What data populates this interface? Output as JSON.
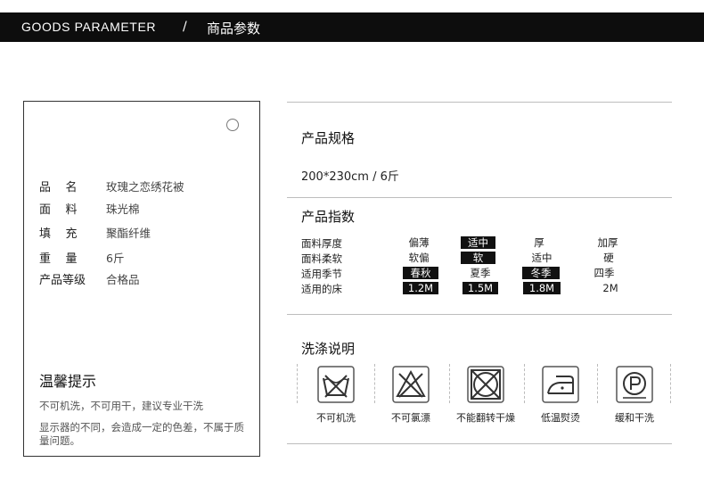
{
  "header": {
    "title_en": "GOODS  PARAMETER",
    "separator": "/",
    "title_cn": "商品参数"
  },
  "card": {
    "rows": [
      {
        "key": "品    名",
        "value": "玫瑰之恋绣花被"
      },
      {
        "key": "面    料",
        "value": "珠光棉"
      },
      {
        "key": "填    充",
        "value": "聚酯纤维"
      },
      {
        "key": "重    量",
        "value": "6斤"
      },
      {
        "key": "产品等级",
        "value": "合格品"
      }
    ],
    "tip_title": "温馨提示",
    "tip_line1": "不可机洗，不可用干，建议专业干洗",
    "tip_line2": "显示器的不同，会造成一定的色差，不属于质量问题。"
  },
  "spec": {
    "title": "产品规格",
    "value": "200*230cm  /  6斤"
  },
  "index": {
    "title": "产品指数",
    "rows": [
      {
        "label": "面料厚度",
        "options": [
          "偏薄",
          "适中",
          "厚",
          "加厚"
        ],
        "selected": 1
      },
      {
        "label": "面料柔软",
        "options": [
          "软偏",
          "软",
          "适中",
          "硬"
        ],
        "selected": 1
      },
      {
        "label": "适用季节",
        "options": [
          "春秋",
          "夏季",
          "冬季",
          "四季"
        ],
        "selected": [
          0,
          2
        ]
      },
      {
        "label": "适用的床",
        "options": [
          "1.2M",
          "1.5M",
          "1.8M",
          "2M"
        ],
        "selected": [
          0,
          1,
          2
        ]
      }
    ]
  },
  "wash": {
    "title": "洗涤说明",
    "items": [
      {
        "icon": "no-machine-wash-icon",
        "label": "不可机洗"
      },
      {
        "icon": "no-bleach-icon",
        "label": "不可氯漂"
      },
      {
        "icon": "no-tumble-dry-icon",
        "label": "不能翻转干燥"
      },
      {
        "icon": "low-iron-icon",
        "label": "低温熨烫"
      },
      {
        "icon": "dry-clean-p-icon",
        "label": "缓和干洗"
      }
    ]
  }
}
